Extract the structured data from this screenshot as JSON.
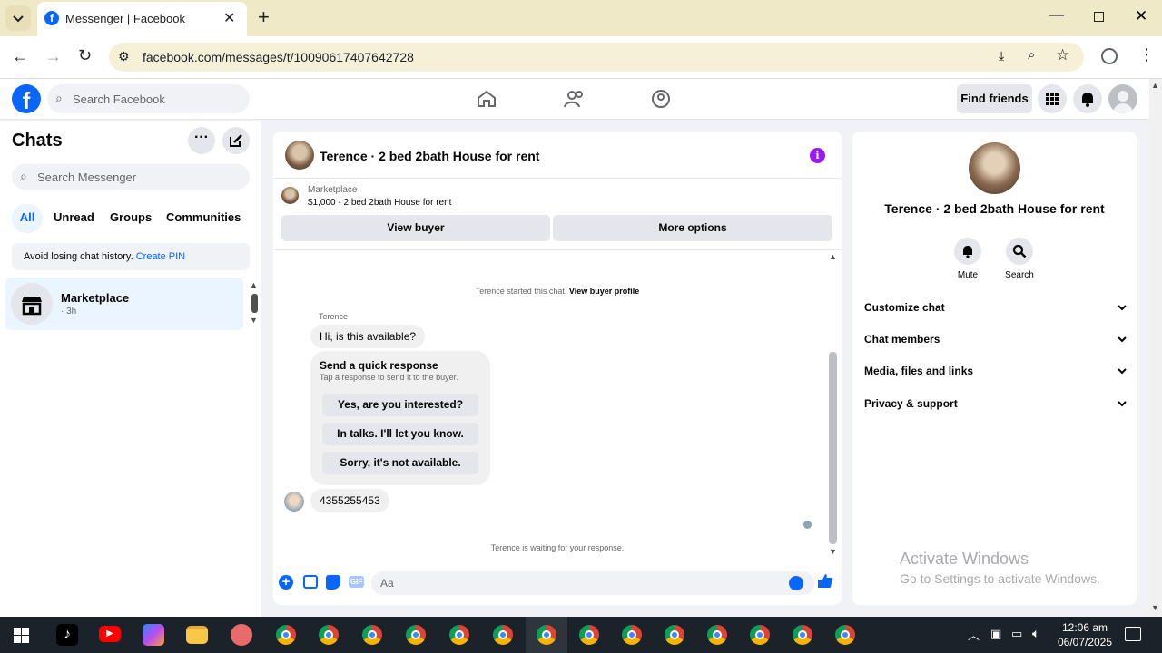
{
  "browser": {
    "tab_title": "Messenger | Facebook",
    "url": "facebook.com/messages/t/10090617407642728"
  },
  "fb_header": {
    "search_placeholder": "Search Facebook",
    "find_friends": "Find friends"
  },
  "sidebar": {
    "title": "Chats",
    "search_placeholder": "Search Messenger",
    "filters": [
      "All",
      "Unread",
      "Groups",
      "Communities"
    ],
    "pin_notice": "Avoid losing chat history.",
    "pin_link": "Create PIN",
    "chat": {
      "name": "Marketplace",
      "time": "· 3h"
    }
  },
  "chat": {
    "title": "Terence · 2 bed 2bath House for rent",
    "marketplace_label": "Marketplace",
    "listing": "$1,000 - 2 bed 2bath House for rent",
    "view_buyer": "View buyer",
    "more_options": "More options",
    "started_text": "Terence started this chat.",
    "view_profile": "View buyer profile",
    "sender": "Terence",
    "msg1": "Hi, is this available?",
    "quick_title": "Send a quick response",
    "quick_sub": "Tap a response to send it to the buyer.",
    "quick_options": [
      "Yes, are you interested?",
      "In talks. I'll let you know.",
      "Sorry, it's not available."
    ],
    "msg2": "4355255453",
    "waiting": "Terence is waiting for your response.",
    "composer_placeholder": "Aa"
  },
  "info": {
    "name": "Terence · 2 bed 2bath House for rent",
    "actions": [
      "Mute",
      "Search"
    ],
    "sections": [
      "Customize chat",
      "Chat members",
      "Media, files and links",
      "Privacy & support"
    ]
  },
  "watermark": {
    "line1": "Activate Windows",
    "line2": "Go to Settings to activate Windows."
  },
  "taskbar": {
    "time": "12:06 am",
    "date": "06/07/2025"
  },
  "colors": {
    "accent": "#0866ff",
    "brand": "#0866ff",
    "info_icon": "#9b19f5"
  }
}
